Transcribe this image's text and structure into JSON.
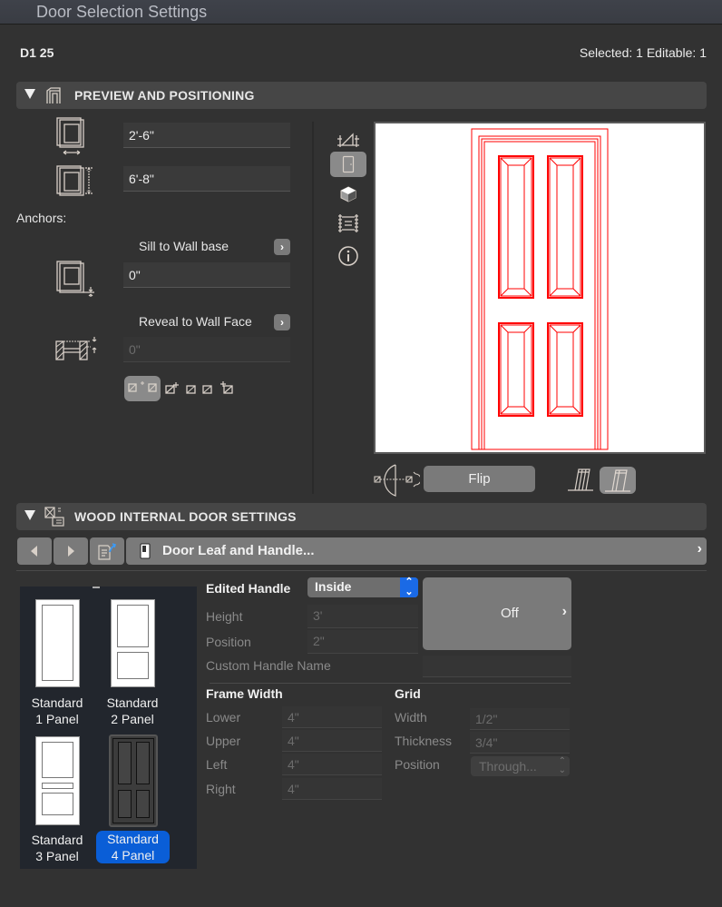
{
  "window": {
    "title": "Door Selection Settings"
  },
  "header": {
    "element_id": "D1 25",
    "selection_status": "Selected: 1 Editable: 1"
  },
  "preview_section": {
    "title": "PREVIEW AND POSITIONING",
    "width_value": "2'-6\"",
    "height_value": "6'-8\"",
    "anchors_label": "Anchors:",
    "sill_anchor_label": "Sill to Wall base",
    "sill_value": "0\"",
    "reveal_anchor_label": "Reveal to Wall Face",
    "reveal_value": "0\"",
    "view_icons": [
      "floor-plan-icon",
      "elevation-icon",
      "3d-box-icon",
      "section-icon",
      "info-icon"
    ],
    "selected_view": "elevation-icon",
    "flip_label": "Flip",
    "preview_color": "#ff0000"
  },
  "settings_section": {
    "title": "WOOD INTERNAL DOOR SETTINGS",
    "page_label": "Door Leaf and Handle...",
    "thumbnails": [
      {
        "line1": "Standard",
        "line2": "1 Panel",
        "selected": false
      },
      {
        "line1": "Standard",
        "line2": "2 Panel",
        "selected": false
      },
      {
        "line1": "Standard",
        "line2": "3 Panel",
        "selected": false
      },
      {
        "line1": "Standard",
        "line2": "4 Panel",
        "selected": true
      }
    ],
    "edited_handle_label": "Edited Handle",
    "edited_handle_value": "Inside",
    "handle_height_label": "Height",
    "handle_height_value": "3'",
    "handle_position_label": "Position",
    "handle_position_value": "2\"",
    "custom_handle_label": "Custom Handle Name",
    "custom_handle_value": "",
    "handle_preview_label": "Off",
    "frame_width": {
      "title": "Frame Width",
      "rows": [
        {
          "label": "Lower",
          "value": "4\""
        },
        {
          "label": "Upper",
          "value": "4\""
        },
        {
          "label": "Left",
          "value": "4\""
        },
        {
          "label": "Right",
          "value": "4\""
        }
      ]
    },
    "grid": {
      "title": "Grid",
      "width_label": "Width",
      "width_value": "1/2\"",
      "thickness_label": "Thickness",
      "thickness_value": "3/4\"",
      "position_label": "Position",
      "position_value": "Through..."
    }
  },
  "colors": {
    "accent": "#0a5ed7",
    "panel_bg": "#323232",
    "section_bg": "#464646"
  }
}
